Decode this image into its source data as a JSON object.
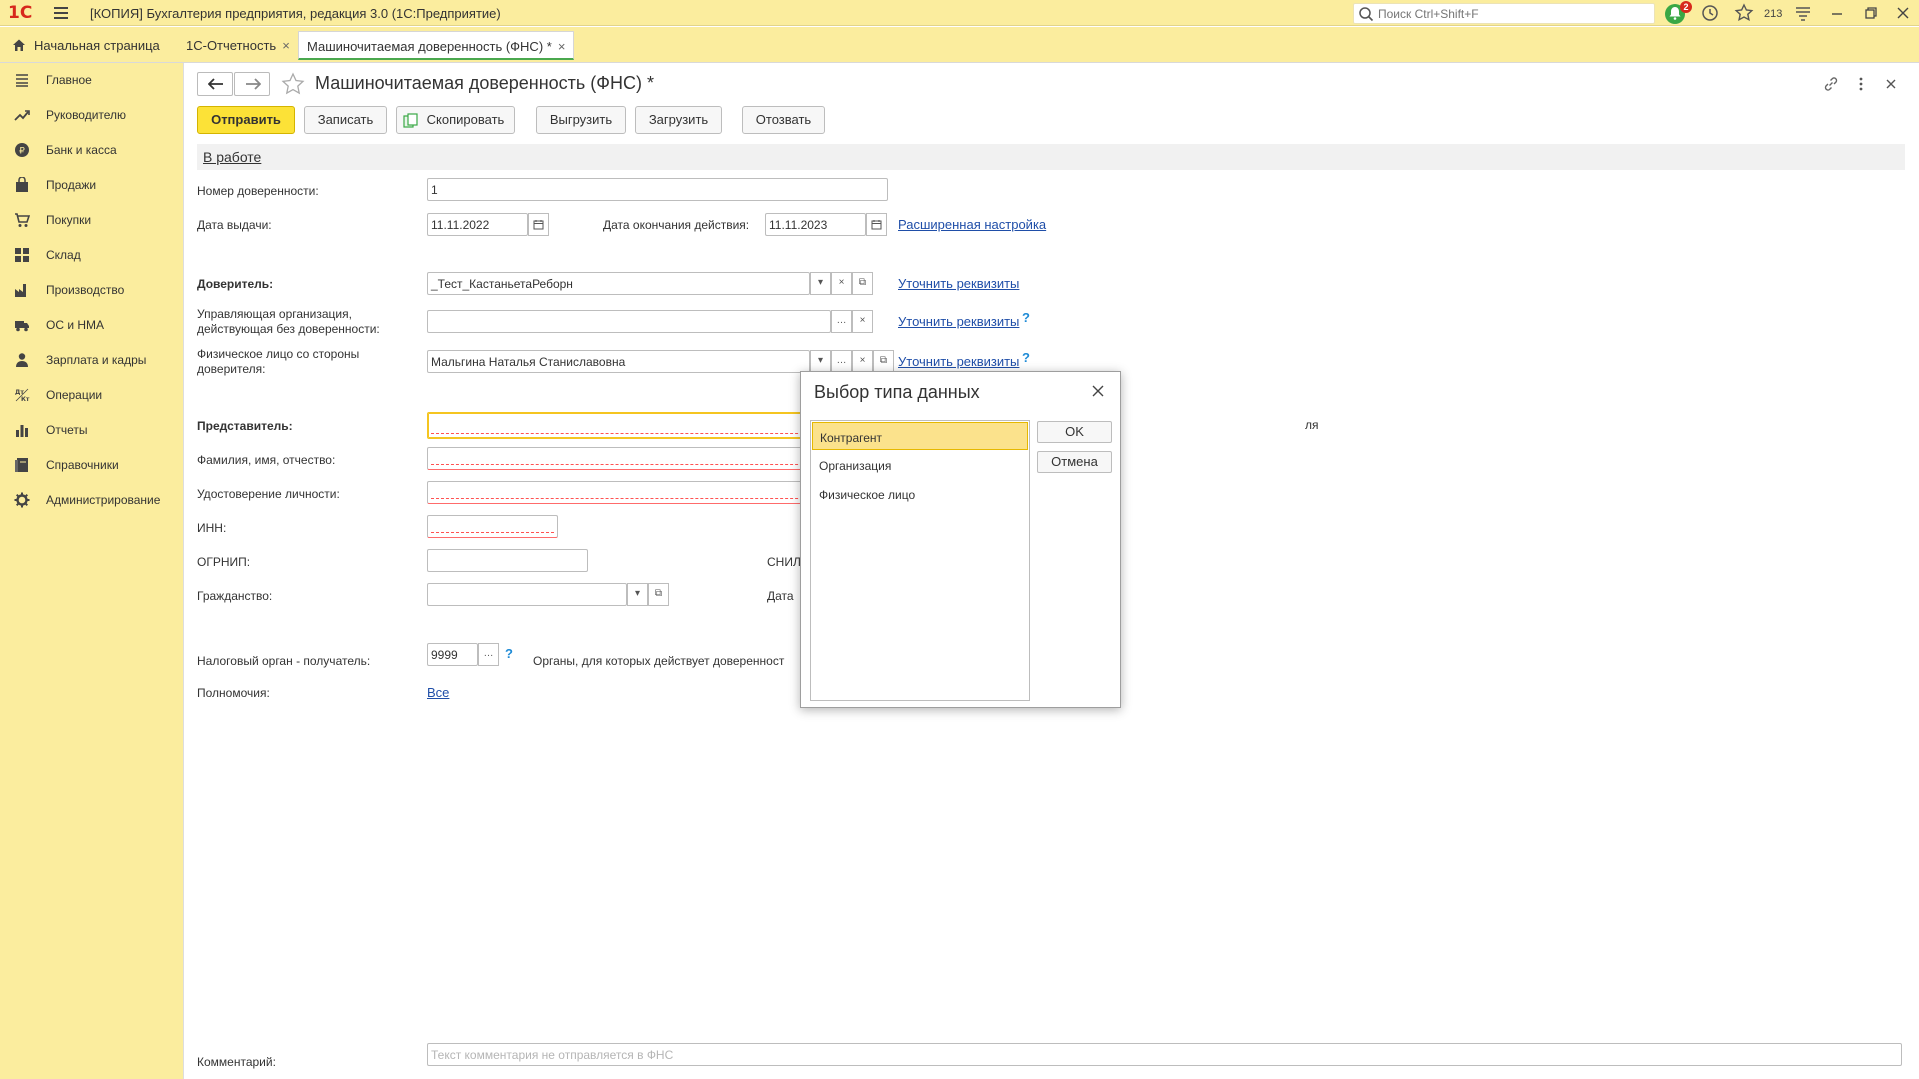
{
  "app": {
    "logo": "1С",
    "title": "[КОПИЯ] Бухгалтерия предприятия, редакция 3.0  (1С:Предприятие)",
    "search_placeholder": "Поиск Ctrl+Shift+F",
    "notifications_count": "2",
    "counter": "213"
  },
  "tabs": [
    {
      "label": "Начальная страница"
    },
    {
      "label": "1С-Отчетность"
    },
    {
      "label": "Машиночитаемая доверенность (ФНС) *"
    }
  ],
  "sidebar": {
    "items": [
      {
        "label": "Главное",
        "icon": "menu-lines-icon"
      },
      {
        "label": "Руководителю",
        "icon": "trend-icon"
      },
      {
        "label": "Банк и касса",
        "icon": "coin-icon"
      },
      {
        "label": "Продажи",
        "icon": "bag-icon"
      },
      {
        "label": "Покупки",
        "icon": "cart-icon"
      },
      {
        "label": "Склад",
        "icon": "boxes-icon"
      },
      {
        "label": "Производство",
        "icon": "factory-icon"
      },
      {
        "label": "ОС и НМА",
        "icon": "truck-icon"
      },
      {
        "label": "Зарплата и кадры",
        "icon": "person-icon"
      },
      {
        "label": "Операции",
        "icon": "dt-kt-icon"
      },
      {
        "label": "Отчеты",
        "icon": "bar-chart-icon"
      },
      {
        "label": "Справочники",
        "icon": "book-icon"
      },
      {
        "label": "Администрирование",
        "icon": "gear-icon"
      }
    ]
  },
  "form": {
    "title": "Машиночитаемая доверенность (ФНС) *",
    "buttons": {
      "send": "Отправить",
      "save": "Записать",
      "copy": "Скопировать",
      "export": "Выгрузить",
      "import": "Загрузить",
      "revoke": "Отозвать"
    },
    "status": "В работе",
    "fields": {
      "number_label": "Номер доверенности:",
      "number_value": "1",
      "issue_date_label": "Дата выдачи:",
      "issue_date_value": "11.11.2022",
      "end_date_label": "Дата окончания действия:",
      "end_date_value": "11.11.2023",
      "advanced_link": "Расширенная настройка",
      "principal_label": "Доверитель:",
      "principal_value": "_Тест_КастаньетаРеборн",
      "clarify_link": "Уточнить реквизиты",
      "managing_org_label": "Управляющая организация, действующая без доверенности:",
      "managing_org_value": "",
      "person_label": "Физическое лицо со стороны доверителя:",
      "person_value": "Мальгина Наталья Станиславовна",
      "representative_label": "Представитель:",
      "fio_label": "Фамилия, имя, отчество:",
      "id_label": "Удостоверение личности:",
      "inn_label": "ИНН:",
      "ogrnip_label": "ОГРНИП:",
      "snils_label": "СНИЛ",
      "citizenship_label": "Гражданство:",
      "date_label": "Дата",
      "right_cut_text": "ля",
      "tax_office_label": "Налоговый орган - получатель:",
      "tax_office_value": "9999",
      "tax_office_hint": "Органы, для которых действует доверенност",
      "powers_label": "Полномочия:",
      "powers_link": "Все",
      "comment_label": "Комментарий:",
      "comment_placeholder": "Текст комментария не отправляется в ФНС"
    }
  },
  "dialog": {
    "title": "Выбор типа данных",
    "items": [
      "Контрагент",
      "Организация",
      "Физическое лицо"
    ],
    "selected_item": "Контрагент",
    "ok": "OK",
    "cancel": "Отмена"
  },
  "colors": {
    "panel_bg": "#fbed9e",
    "primary_button": "#fce237",
    "link": "#1f4ea8",
    "selection": "#fbe28c",
    "required_underline": "#ff5252"
  }
}
